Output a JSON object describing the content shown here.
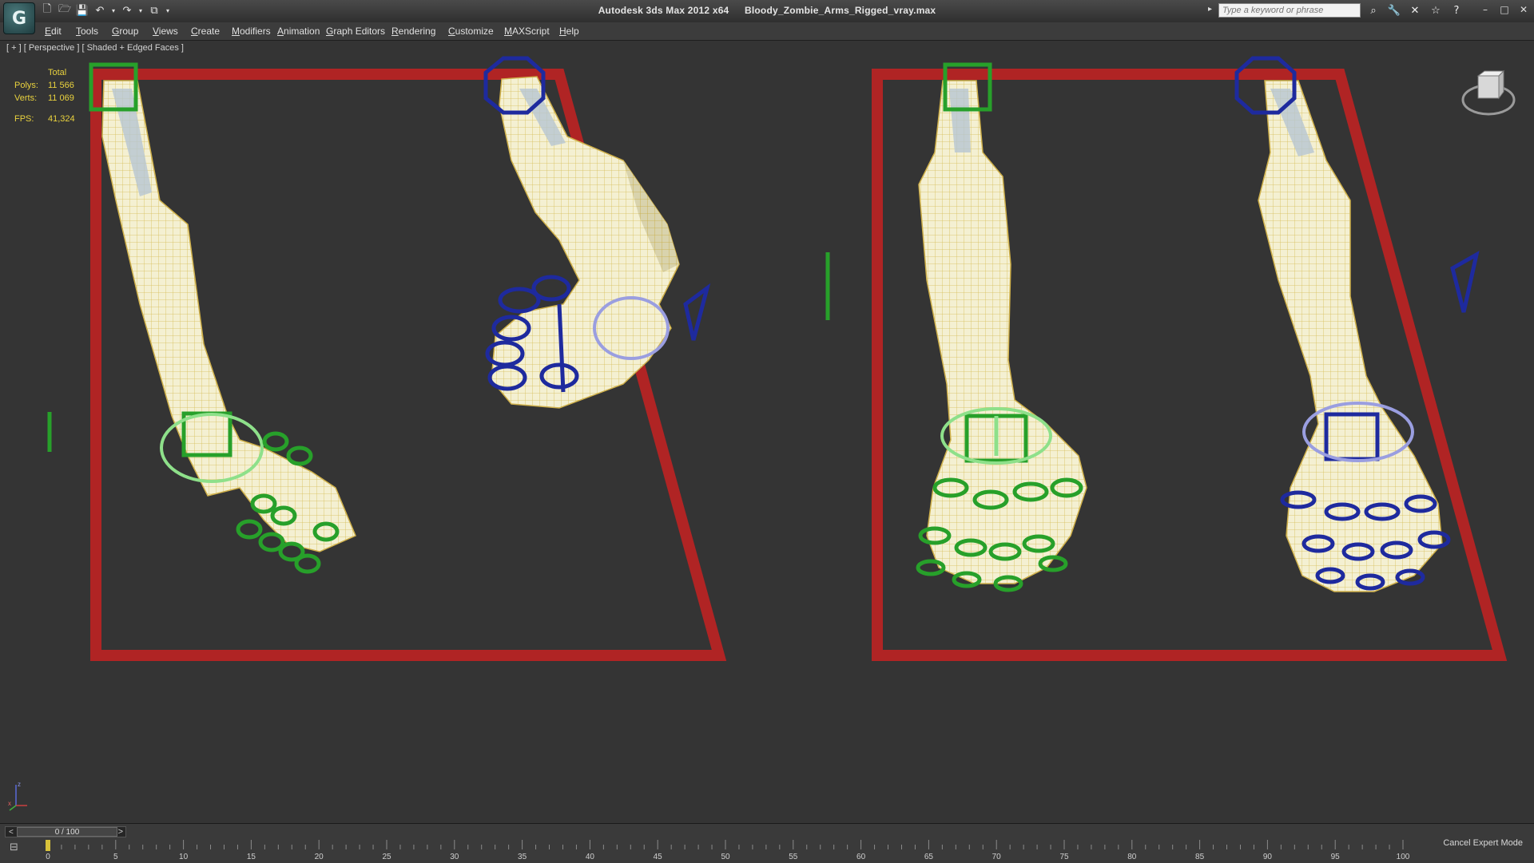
{
  "titlebar": {
    "app_title": "Autodesk 3ds Max  2012 x64",
    "file_name": "Bloody_Zombie_Arms_Rigged_vray.max",
    "search_placeholder": "Type a keyword or phrase",
    "logo_glyph": "G"
  },
  "quick_access": {
    "icons": [
      "new-file-icon",
      "open-file-icon",
      "save-icon",
      "undo-icon",
      "redo-icon",
      "project-folder-icon",
      "customize-dropdown-icon"
    ]
  },
  "right_tools": {
    "icons": [
      "binoculars-icon",
      "wrench-icon",
      "subscription-icon",
      "star-icon",
      "help-icon"
    ]
  },
  "menu": {
    "items": [
      "Edit",
      "Tools",
      "Group",
      "Views",
      "Create",
      "Modifiers",
      "Animation",
      "Graph Editors",
      "Rendering",
      "Customize",
      "MAXScript",
      "Help"
    ]
  },
  "viewport": {
    "label": "[ + ] [ Perspective ] [ Shaded + Edged Faces ]",
    "stats": {
      "header": "Total",
      "polys_label": "Polys:",
      "polys_value": "11 566",
      "verts_label": "Verts:",
      "verts_value": "11 069",
      "fps_label": "FPS:",
      "fps_value": "41,324"
    },
    "axis_labels": {
      "z": "z",
      "x": "x"
    },
    "colors": {
      "background": "#343434",
      "frame_red": "#b02424",
      "control_green": "#27a02a",
      "control_blue": "#1e2a9e",
      "mesh_fill": "#f3efcf",
      "mesh_wire": "#d9c15a",
      "stats_yellow": "#e9d23e"
    }
  },
  "timeline": {
    "frame_display": "0 / 100",
    "prev_arrow": "<",
    "next_arrow": ">",
    "ticks": [
      "0",
      "5",
      "10",
      "15",
      "20",
      "25",
      "30",
      "35",
      "40",
      "45",
      "50",
      "55",
      "60",
      "65",
      "70",
      "75",
      "80",
      "85",
      "90",
      "95",
      "100"
    ],
    "cancel_expert_mode": "Cancel Expert Mode"
  }
}
